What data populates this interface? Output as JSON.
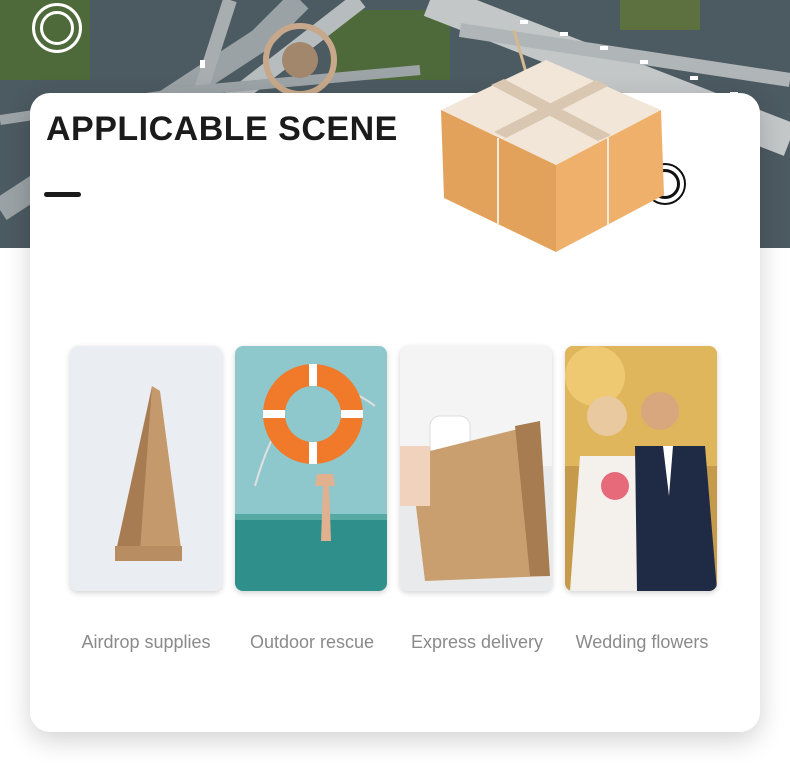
{
  "section": {
    "title": "APPLICABLE SCENE"
  },
  "scenes": [
    {
      "label": "Airdrop supplies",
      "icon": "paper-bag"
    },
    {
      "label": "Outdoor rescue",
      "icon": "lifebuoy"
    },
    {
      "label": "Express delivery",
      "icon": "delivery-bag"
    },
    {
      "label": "Wedding flowers",
      "icon": "wedding-couple"
    }
  ],
  "colors": {
    "kraft": "#c9a274",
    "lifebuoy": "#f07a2a",
    "sea": "#2f8f8a",
    "title": "#1b1b1b",
    "caption": "#8a8a8a"
  }
}
